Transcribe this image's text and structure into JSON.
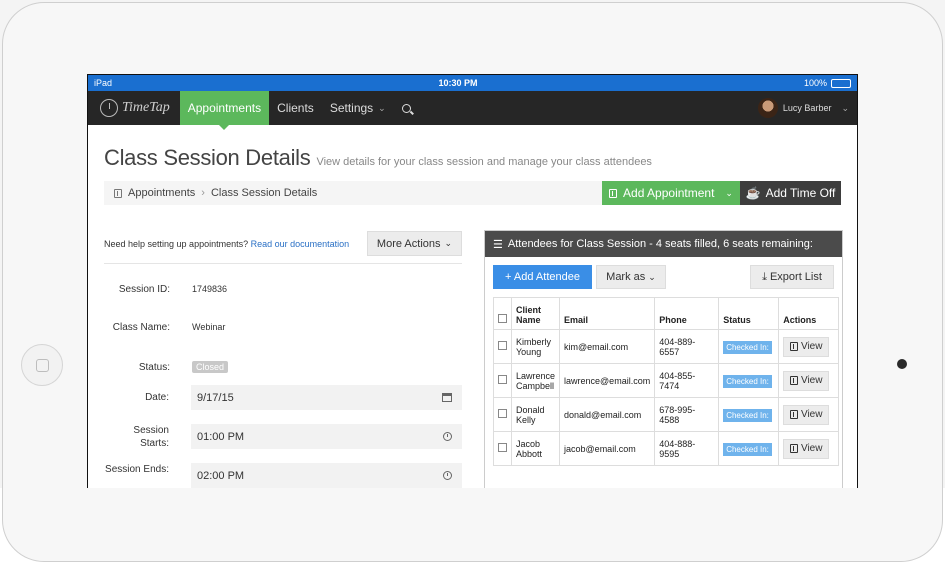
{
  "statusbar": {
    "device": "iPad",
    "time": "10:30 PM",
    "battery": "100%"
  },
  "nav": {
    "logo": "TimeTap",
    "items": [
      {
        "label": "Appointments",
        "active": true
      },
      {
        "label": "Clients"
      },
      {
        "label": "Settings"
      }
    ],
    "user": "Lucy Barber"
  },
  "page": {
    "title": "Class Session Details",
    "subtitle": "View details for your class session and manage your class attendees"
  },
  "breadcrumb": {
    "root": "Appointments",
    "current": "Class Session Details"
  },
  "actions": {
    "add_appointment": "Add Appointment",
    "add_time_off": "Add Time Off"
  },
  "help": {
    "text": "Need help setting up appointments?",
    "link": "Read our documentation",
    "more_actions": "More Actions"
  },
  "details": {
    "session_id_label": "Session ID:",
    "session_id": "1749836",
    "class_name_label": "Class Name:",
    "class_name": "Webinar",
    "status_label": "Status:",
    "status": "Closed",
    "date_label": "Date:",
    "date": "9/17/15",
    "starts_label": "Session Starts:",
    "starts": "01:00 PM",
    "ends_label": "Session Ends:",
    "ends": "02:00 PM"
  },
  "attendees": {
    "header": "Attendees for Class Session - 4 seats filled, 6 seats remaining:",
    "add_button": "+ Add Attendee",
    "mark_button": "Mark as",
    "export_button": "Export List",
    "columns": [
      "Client Name",
      "Email",
      "Phone",
      "Status",
      "Actions"
    ],
    "rows": [
      {
        "name": "Kimberly Young",
        "email": "kim@email.com",
        "phone": "404-889-6557",
        "status": "Checked In:",
        "action": "View"
      },
      {
        "name": "Lawrence Campbell",
        "email": "lawrence@email.com",
        "phone": "404-855-7474",
        "status": "Checked In:",
        "action": "View"
      },
      {
        "name": "Donald Kelly",
        "email": "donald@email.com",
        "phone": "678-995-4588",
        "status": "Checked In:",
        "action": "View"
      },
      {
        "name": "Jacob Abbott",
        "email": "jacob@email.com",
        "phone": "404-888-9595",
        "status": "Checked In:",
        "action": "View"
      }
    ]
  },
  "colors": {
    "nav_bg": "#262626",
    "green": "#5cb85c",
    "blue": "#3a8ee6",
    "status_blue": "#1a6fd0"
  }
}
